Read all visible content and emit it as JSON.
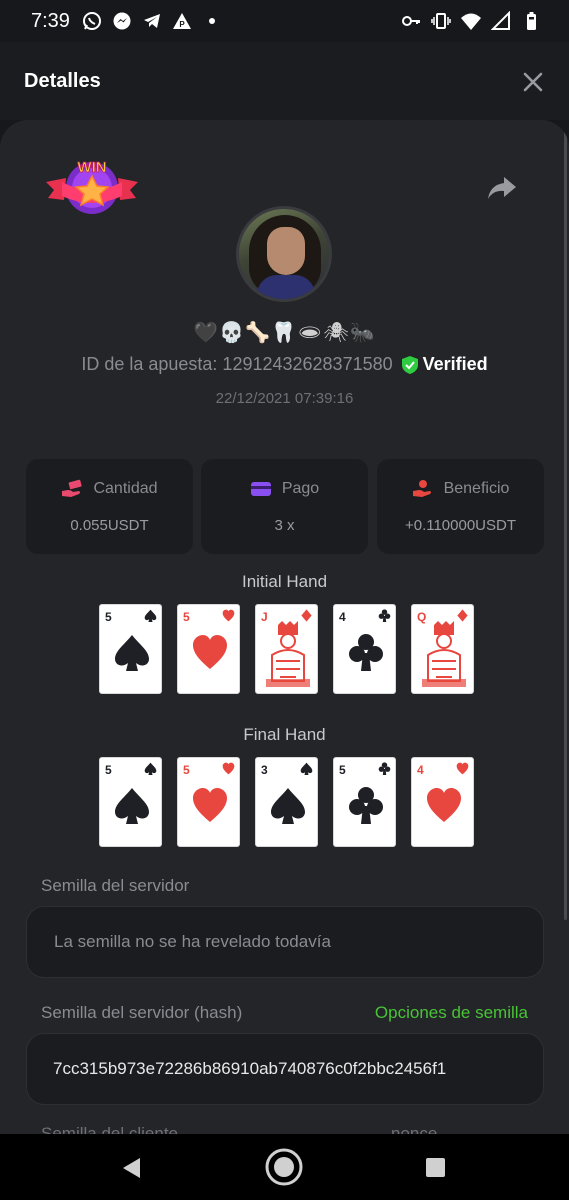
{
  "status_bar": {
    "time": "7:39",
    "left_icons": [
      "whatsapp-icon",
      "messenger-icon",
      "telegram-icon",
      "parking-icon",
      "dot-icon"
    ],
    "right_icons": [
      "key-icon",
      "vibrate-icon",
      "wifi-icon",
      "signal-icon",
      "battery-icon"
    ]
  },
  "header": {
    "title": "Detalles"
  },
  "details": {
    "username": "🖤💀🦴🦷🕳🕷🐜",
    "bet_id": "ID de la apuesta: 12912432628371580",
    "verified_label": "Verified",
    "timestamp": "22/12/2021 07:39:16",
    "stats": [
      {
        "label": "Cantidad",
        "value": "0.055USDT",
        "icon": "money-hand-icon",
        "color": "#e84a6f"
      },
      {
        "label": "Pago",
        "value": "3 x",
        "icon": "card-icon",
        "color": "#8a4ff0"
      },
      {
        "label": "Beneficio",
        "value": "+0.110000USDT",
        "icon": "profit-hand-icon",
        "color": "#e8473f"
      }
    ]
  },
  "initial_hand": {
    "title": "Initial Hand",
    "cards": [
      {
        "rank": "5",
        "suit": "spade"
      },
      {
        "rank": "5",
        "suit": "heart"
      },
      {
        "rank": "J",
        "suit": "diamond"
      },
      {
        "rank": "4",
        "suit": "club"
      },
      {
        "rank": "Q",
        "suit": "diamond"
      }
    ]
  },
  "final_hand": {
    "title": "Final Hand",
    "cards": [
      {
        "rank": "5",
        "suit": "spade"
      },
      {
        "rank": "5",
        "suit": "heart"
      },
      {
        "rank": "3",
        "suit": "spade"
      },
      {
        "rank": "5",
        "suit": "club"
      },
      {
        "rank": "4",
        "suit": "heart"
      }
    ]
  },
  "seeds": {
    "server_seed_label": "Semilla del servidor",
    "server_seed_value": "La semilla no se ha revelado todavía",
    "server_hash_label": "Semilla del servidor (hash)",
    "seed_options_link": "Opciones de semilla",
    "server_hash_value": "7cc315b973e72286b86910ab740876c0f2bbc2456f1",
    "client_seed_label": "Semilla del cliente",
    "nonce_label": "nonce"
  },
  "colors": {
    "background": "#17181b",
    "panel": "#242528",
    "card_bg": "#1b1c1f",
    "verified_green": "#2ecc40",
    "link_green": "#48c437",
    "red_suit": "#e8473f"
  }
}
